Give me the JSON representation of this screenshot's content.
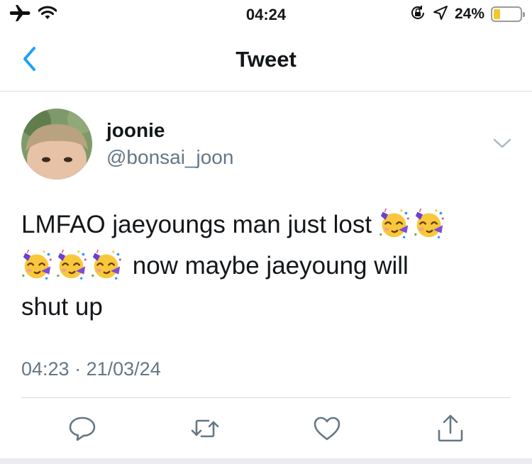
{
  "status_bar": {
    "time": "04:24",
    "battery_percent_label": "24%",
    "battery_level": 0.24,
    "battery_color": "#f4c82b",
    "icons": [
      "airplane-icon",
      "wifi-icon",
      "orientation-lock-icon",
      "location-arrow-icon",
      "battery-icon"
    ]
  },
  "nav": {
    "title": "Tweet",
    "back_icon": "chevron-left-icon",
    "accent_color": "#1da1f2"
  },
  "tweet": {
    "author": {
      "display_name": "joonie",
      "handle": "@bonsai_joon"
    },
    "text_lines": [
      "LMFAO jaeyoungs man just lost ",
      " now maybe jaeyoung will",
      "shut up"
    ],
    "emoji": "partying-face",
    "timestamp": {
      "time": "04:23",
      "separator": "·",
      "date": "21/03/24"
    },
    "menu_icon": "chevron-down-icon",
    "actions": [
      "reply-icon",
      "retweet-icon",
      "like-icon",
      "share-icon"
    ]
  },
  "colors": {
    "text_primary": "#14171a",
    "text_secondary": "#657786",
    "divider": "#d6d9dc"
  }
}
